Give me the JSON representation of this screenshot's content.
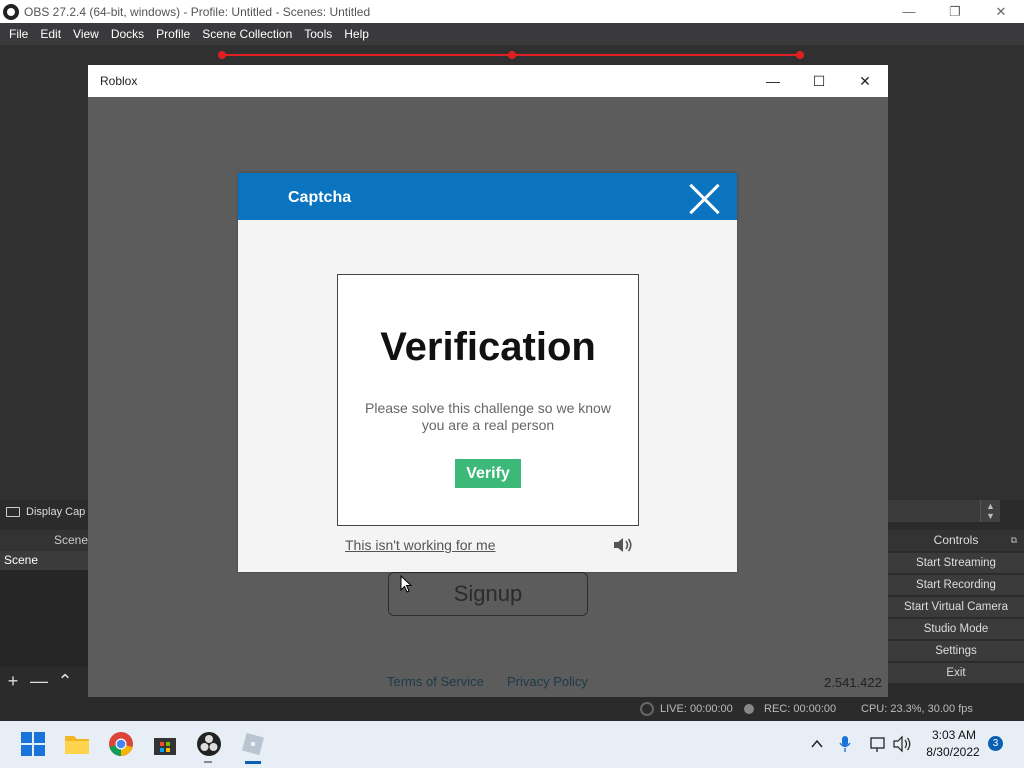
{
  "obs": {
    "window_title": "OBS 27.2.4 (64-bit, windows) - Profile: Untitled - Scenes: Untitled",
    "menu": [
      "File",
      "Edit",
      "View",
      "Docks",
      "Profile",
      "Scene Collection",
      "Tools",
      "Help"
    ],
    "source_label": "Display Cap",
    "scenes_header": "Scene",
    "scene_item": "Scene",
    "controls_header": "Controls",
    "controls": [
      "Start Streaming",
      "Start Recording",
      "Start Virtual Camera",
      "Studio Mode",
      "Settings",
      "Exit"
    ],
    "status": {
      "live": "LIVE: 00:00:00",
      "rec": "REC: 00:00:00",
      "cpu": "CPU: 23.3%, 30.00 fps"
    }
  },
  "roblox": {
    "window_title": "Roblox",
    "signup_label": "Signup",
    "terms_label": "Terms of Service",
    "privacy_label": "Privacy Policy",
    "counter": "2.541.422"
  },
  "captcha": {
    "title": "Captcha",
    "heading": "Verification",
    "description": "Please solve this challenge so we know you are a real person",
    "verify_label": "Verify",
    "not_working_label": "This isn't working for me"
  },
  "taskbar": {
    "time": "3:03 AM",
    "date": "8/30/2022",
    "notification_count": "3",
    "apps": [
      "start-icon",
      "file-explorer-icon",
      "chrome-icon",
      "store-icon",
      "obs-icon",
      "roblox-icon"
    ]
  },
  "colors": {
    "captcha_header": "#0a74c0",
    "verify_button": "#3cb878",
    "selection_red": "#e02020"
  }
}
